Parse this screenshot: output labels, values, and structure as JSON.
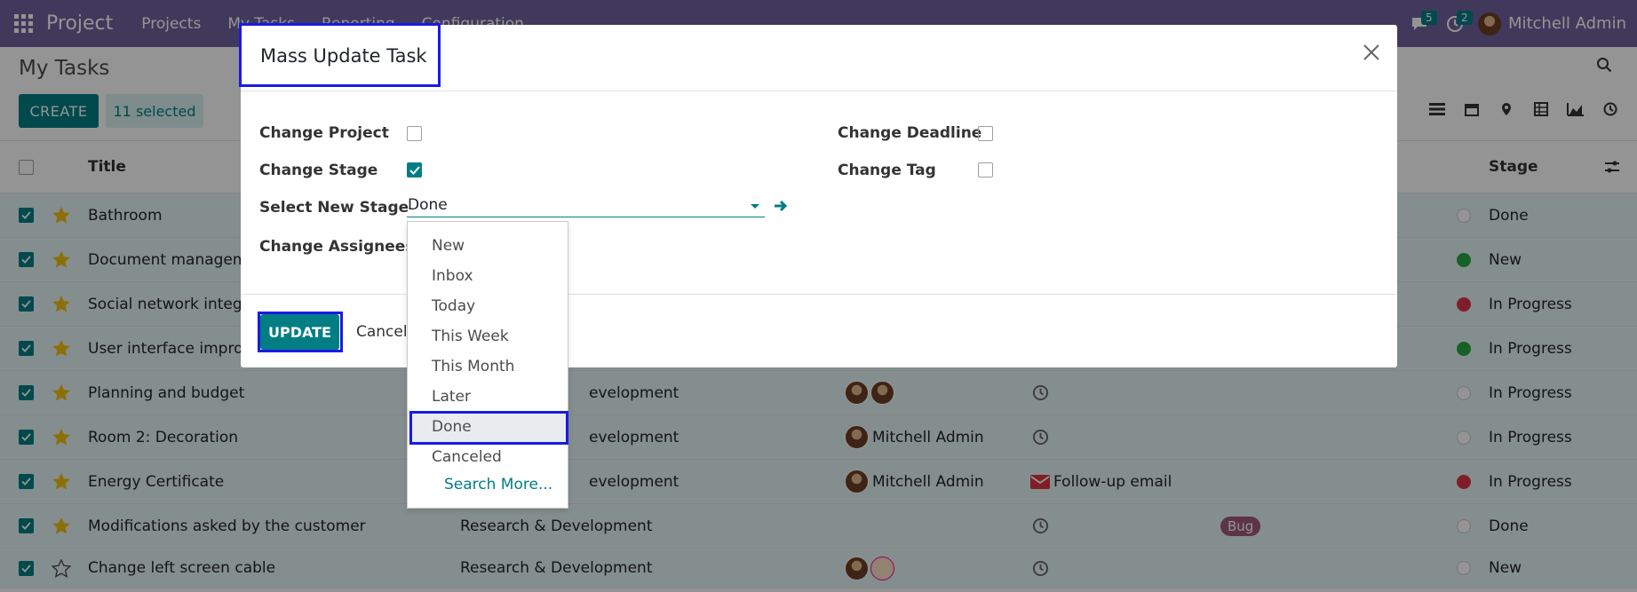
{
  "navbar": {
    "app_name": "Project",
    "menus": [
      "Projects",
      "My Tasks",
      "Reporting",
      "Configuration"
    ],
    "messages_count": "5",
    "activities_count": "2",
    "user_name": "Mitchell Admin",
    "bg_color": "#71639e"
  },
  "control_panel": {
    "title": "My Tasks",
    "create_label": "CREATE",
    "selected_label": "11 selected"
  },
  "list": {
    "columns": {
      "title": "Title",
      "stage": "Stage"
    },
    "rows": [
      {
        "title": "Bathroom",
        "project": "",
        "assignee": "",
        "activity": "",
        "tag": "",
        "stage": "Done",
        "status": "grey",
        "starred": true
      },
      {
        "title": "Document manageme",
        "project": "",
        "assignee": "",
        "activity": "",
        "tag": "",
        "stage": "New",
        "status": "green",
        "starred": true
      },
      {
        "title": "Social network integra",
        "project": "",
        "assignee": "",
        "activity": "",
        "tag": "",
        "stage": "In Progress",
        "status": "red",
        "starred": true
      },
      {
        "title": "User interface improv",
        "project": "",
        "assignee": "",
        "activity": "",
        "tag": "",
        "stage": "In Progress",
        "status": "green",
        "starred": true
      },
      {
        "title": "Planning and budget",
        "project": "evelopment",
        "assignee": "",
        "activity": "",
        "tag": "",
        "stage": "In Progress",
        "status": "grey",
        "starred": true
      },
      {
        "title": "Room 2: Decoration",
        "project": "evelopment",
        "assignee": "Mitchell Admin",
        "activity": "",
        "tag": "",
        "stage": "In Progress",
        "status": "grey",
        "starred": true
      },
      {
        "title": "Energy Certificate",
        "project": "evelopment",
        "assignee": "Mitchell Admin",
        "activity": "Follow-up email",
        "tag": "",
        "stage": "In Progress",
        "status": "red",
        "starred": true
      },
      {
        "title": "Modifications asked by the customer",
        "project": "Research & Development",
        "assignee": "",
        "activity": "",
        "tag": "Bug",
        "stage": "Done",
        "status": "grey",
        "starred": true
      },
      {
        "title": "Change left screen cable",
        "project": "Research & Development",
        "assignee": "",
        "activity": "",
        "tag": "",
        "stage": "New",
        "status": "grey",
        "starred": false
      }
    ]
  },
  "modal": {
    "title": "Mass Update Task",
    "change_project": "Change Project",
    "change_stage": "Change Stage",
    "select_new_stage": "Select New Stage",
    "change_assignees": "Change Assignees",
    "change_deadline": "Change Deadline",
    "change_tag": "Change Tag",
    "stage_value": "Done",
    "update_label": "UPDATE",
    "cancel_label": "Cancel"
  },
  "dropdown": {
    "options": [
      "New",
      "Inbox",
      "Today",
      "This Week",
      "This Month",
      "Later",
      "Done",
      "Canceled"
    ],
    "selected": "Done",
    "search_more": "Search More..."
  },
  "colors": {
    "primary": "#017e84",
    "highlight": "#1a1ae6",
    "tag_bug": "#a05a7a"
  }
}
